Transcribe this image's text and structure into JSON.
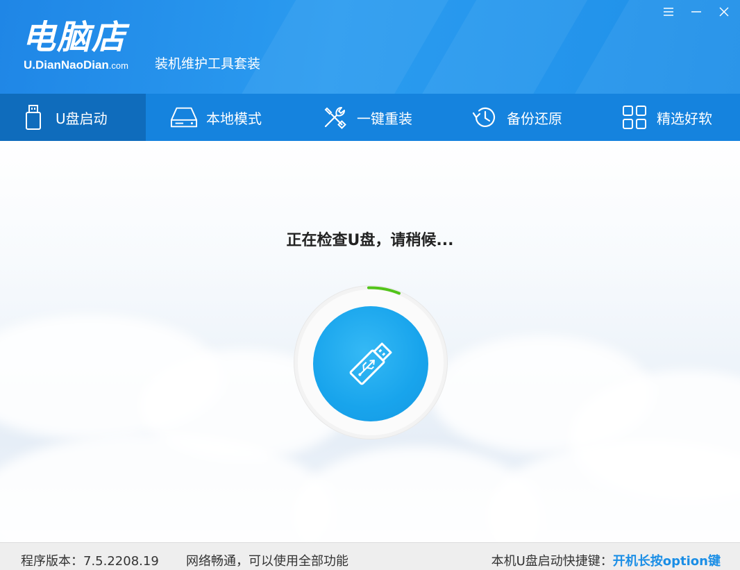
{
  "window": {
    "brand": "电脑店",
    "url_main": "U.DianNaoDian",
    "url_suffix": ".com",
    "subtitle": "装机维护工具套装",
    "controls": [
      "menu-icon",
      "minimize-icon",
      "close-icon"
    ],
    "accent_color": "#1e8fe8"
  },
  "nav": {
    "items": [
      {
        "label": "U盘启动",
        "icon": "usb-drive-icon",
        "active": true
      },
      {
        "label": "本地模式",
        "icon": "hard-drive-icon",
        "active": false
      },
      {
        "label": "一键重装",
        "icon": "tools-icon",
        "active": false
      },
      {
        "label": "备份还原",
        "icon": "history-icon",
        "active": false
      },
      {
        "label": "精选好软",
        "icon": "apps-grid-icon",
        "active": false
      }
    ]
  },
  "main": {
    "status": "正在检查U盘，请稍候...",
    "center_icon": "usb-icon",
    "progress_color": "#52c41a"
  },
  "statusbar": {
    "version": "程序版本：7.5.2208.19",
    "network": "网络畅通，可以使用全部功能",
    "hotkey_label": "本机U盘启动快捷键：",
    "hotkey_value": "开机长按option键"
  }
}
